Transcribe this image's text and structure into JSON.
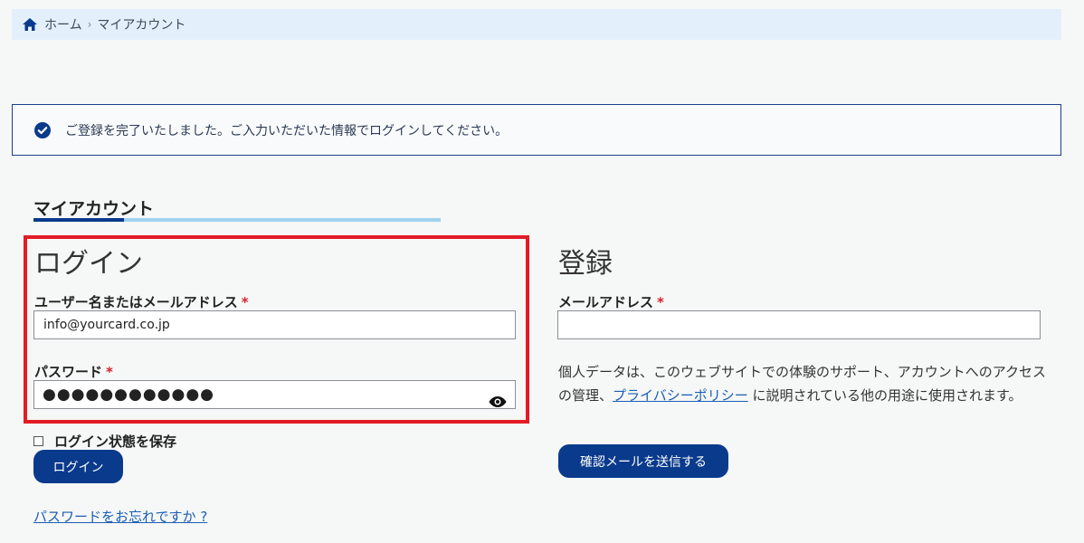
{
  "breadcrumb": {
    "home": "ホーム",
    "separator": "›",
    "current": "マイアカウント",
    "icon": "home-icon"
  },
  "notice": {
    "icon": "check-circle-icon",
    "message": "ご登録を完了いたしました。ご入力いただいた情報でログインしてください。"
  },
  "page_title": "マイアカウント",
  "login": {
    "heading": "ログイン",
    "username_label": "ユーザー名またはメールアドレス",
    "required_mark": "*",
    "username_value": "info@yourcard.co.jp",
    "password_label": "パスワード",
    "password_mask": "●●●●●●●●●●●●",
    "show_password_icon": "eye-icon",
    "remember_label": "ログイン状態を保存",
    "submit_label": "ログイン",
    "forgot_link": "パスワードをお忘れですか ?"
  },
  "register": {
    "heading": "登録",
    "email_label": "メールアドレス",
    "required_mark": "*",
    "email_value": "",
    "privacy_before": "個人データは、このウェブサイトでの体験のサポート、アカウントへのアクセスの管理、",
    "privacy_link": "プライバシーポリシー",
    "privacy_after": " に説明されている他の用途に使用されます。",
    "submit_label": "確認メールを送信する"
  },
  "colors": {
    "primary": "#0a3a8c",
    "highlight_border": "#e31c25",
    "breadcrumb_bg": "#e3f0fb",
    "link": "#1a5fb4",
    "required": "#d0242b"
  }
}
